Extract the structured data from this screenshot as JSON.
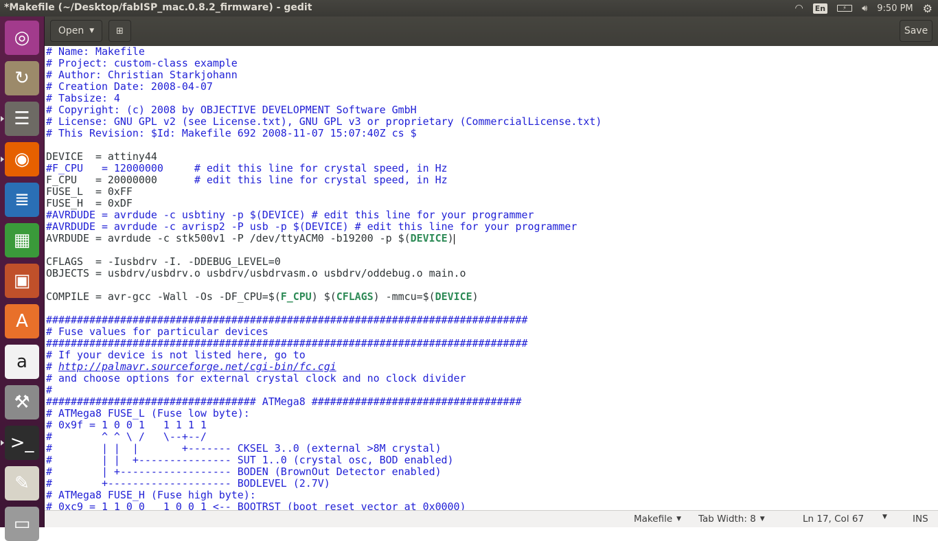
{
  "window": {
    "title": "*Makefile (~/Desktop/fabISP_mac.0.8.2_firmware) - gedit"
  },
  "indicators": {
    "keyboard": "En",
    "clock": "9:50 PM",
    "icons": [
      "wifi-icon",
      "battery-icon",
      "volume-icon",
      "power-gear-icon"
    ]
  },
  "launcher": {
    "items": [
      "ubuntu-dash",
      "backup",
      "files",
      "firefox",
      "libreoffice-writer",
      "libreoffice-calc",
      "libreoffice-impress",
      "software-center",
      "amazon",
      "system-settings",
      "terminal",
      "text-editor",
      "disk"
    ]
  },
  "toolbar": {
    "open_label": "Open",
    "save_label": "Save"
  },
  "editor": {
    "lines": [
      [
        [
          "# Name: Makefile",
          "c"
        ]
      ],
      [
        [
          "# Project: custom-class example",
          "c"
        ]
      ],
      [
        [
          "# Author: Christian Starkjohann",
          "c"
        ]
      ],
      [
        [
          "# Creation Date: 2008-04-07",
          "c"
        ]
      ],
      [
        [
          "# Tabsize: 4",
          "c"
        ]
      ],
      [
        [
          "# Copyright: (c) 2008 by OBJECTIVE DEVELOPMENT Software GmbH",
          "c"
        ]
      ],
      [
        [
          "# License: GNU GPL v2 (see License.txt), GNU GPL v3 or proprietary (CommercialLicense.txt)",
          "c"
        ]
      ],
      [
        [
          "# This Revision: $Id: Makefile 692 2008-11-07 15:07:40Z cs $",
          "c"
        ]
      ],
      [],
      [
        [
          "DEVICE  = attiny44",
          "n"
        ]
      ],
      [
        [
          "#F_CPU   = 12000000     # edit this line for crystal speed, in Hz",
          "c"
        ]
      ],
      [
        [
          "F_CPU   = 20000000      ",
          "n"
        ],
        [
          "# edit this line for crystal speed, in Hz",
          "c"
        ]
      ],
      [
        [
          "FUSE_L  = 0xFF",
          "n"
        ]
      ],
      [
        [
          "FUSE_H  = 0xDF",
          "n"
        ]
      ],
      [
        [
          "#AVRDUDE = avrdude -c usbtiny -p $(DEVICE) # edit this line for your programmer",
          "c"
        ]
      ],
      [
        [
          "#AVRDUDE = avrdude -c avrisp2 -P usb -p $(DEVICE) # edit this line for your programmer",
          "c"
        ]
      ],
      [
        [
          "AVRDUDE = avrdude -c stk500v1 -P /dev/ttyACM0 -b19200 -p $(",
          "n"
        ],
        [
          "DEVICE",
          "v"
        ],
        [
          ")",
          "n"
        ]
      ],
      [],
      [
        [
          "CFLAGS  = -Iusbdrv -I. -DDEBUG_LEVEL=0",
          "n"
        ]
      ],
      [
        [
          "OBJECTS = usbdrv/usbdrv.o usbdrv/usbdrvasm.o usbdrv/oddebug.o main.o",
          "n"
        ]
      ],
      [],
      [
        [
          "COMPILE = avr-gcc -Wall -Os -DF_CPU=$(",
          "n"
        ],
        [
          "F_CPU",
          "v"
        ],
        [
          ") $(",
          "n"
        ],
        [
          "CFLAGS",
          "v"
        ],
        [
          ") -mmcu=$(",
          "n"
        ],
        [
          "DEVICE",
          "v"
        ],
        [
          ")",
          "n"
        ]
      ],
      [],
      [
        [
          "##############################################################################",
          "c"
        ]
      ],
      [
        [
          "# Fuse values for particular devices",
          "c"
        ]
      ],
      [
        [
          "##############################################################################",
          "c"
        ]
      ],
      [
        [
          "# If your device is not listed here, go to",
          "c"
        ]
      ],
      [
        [
          "# ",
          "c"
        ],
        [
          "http://palmavr.sourceforge.net/cgi-bin/fc.cgi",
          "u"
        ]
      ],
      [
        [
          "# and choose options for external crystal clock and no clock divider",
          "c"
        ]
      ],
      [
        [
          "#",
          "c"
        ]
      ],
      [
        [
          "################################## ATMega8 ##################################",
          "c"
        ]
      ],
      [
        [
          "# ATMega8 FUSE_L (Fuse low byte):",
          "c"
        ]
      ],
      [
        [
          "# 0x9f = 1 0 0 1   1 1 1 1",
          "c"
        ]
      ],
      [
        [
          "#        ^ ^ \\ /   \\--+--/",
          "c"
        ]
      ],
      [
        [
          "#        | |  |       +------- CKSEL 3..0 (external >8M crystal)",
          "c"
        ]
      ],
      [
        [
          "#        | |  +--------------- SUT 1..0 (crystal osc, BOD enabled)",
          "c"
        ]
      ],
      [
        [
          "#        | +------------------ BODEN (BrownOut Detector enabled)",
          "c"
        ]
      ],
      [
        [
          "#        +-------------------- BODLEVEL (2.7V)",
          "c"
        ]
      ],
      [
        [
          "# ATMega8 FUSE_H (Fuse high byte):",
          "c"
        ]
      ],
      [
        [
          "# 0xc9 = 1 1 0 0   1 0 0 1 <-- BOOTRST (boot reset vector at 0x0000)",
          "c"
        ]
      ]
    ],
    "cursor_line": 17
  },
  "statusbar": {
    "language": "Makefile",
    "tab_width": "Tab Width: 8",
    "position": "Ln 17, Col 67",
    "mode": "INS"
  }
}
